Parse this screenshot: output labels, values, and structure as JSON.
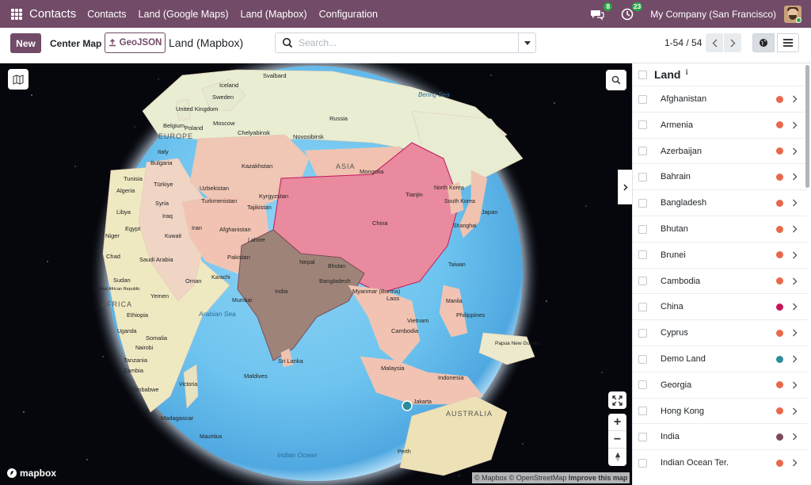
{
  "navbar": {
    "app_name": "Contacts",
    "menu": [
      "Contacts",
      "Land (Google Maps)",
      "Land (Mapbox)",
      "Configuration"
    ],
    "messages_count": "8",
    "activities_count": "23",
    "company": "My Company (San Francisco)"
  },
  "control": {
    "new_label": "New",
    "center_map_label": "Center Map",
    "geojson_label": "GeoJSON",
    "breadcrumb": "Land (Mapbox)",
    "search_placeholder": "Search...",
    "pager": "1-54 / 54"
  },
  "map": {
    "attribution_mapbox": "© Mapbox",
    "attribution_osm": "© OpenStreetMap",
    "attribution_improve": "Improve this map",
    "logo_text": "mapbox",
    "labels": [
      {
        "t": "Svalbard"
      },
      {
        "t": "Iceland"
      },
      {
        "t": "Sweden"
      },
      {
        "t": "Russia"
      },
      {
        "t": "United Kingdom"
      },
      {
        "t": "Moscow"
      },
      {
        "t": "Belgium"
      },
      {
        "t": "Poland"
      },
      {
        "t": "Chelyabinsk"
      },
      {
        "t": "Novosibirsk"
      },
      {
        "t": "EUROPE"
      },
      {
        "t": "Italy"
      },
      {
        "t": "Bulgaria"
      },
      {
        "t": "Kazakhstan"
      },
      {
        "t": "Mongolia"
      },
      {
        "t": "ASIA"
      },
      {
        "t": "Tunisia"
      },
      {
        "t": "Türkiye"
      },
      {
        "t": "Uzbekistan"
      },
      {
        "t": "Algeria"
      },
      {
        "t": "Syria"
      },
      {
        "t": "Kyrgyzstan"
      },
      {
        "t": "Turkmenistan"
      },
      {
        "t": "Tajikistan"
      },
      {
        "t": "North Korea"
      },
      {
        "t": "Tianjin"
      },
      {
        "t": "Libya"
      },
      {
        "t": "Iraq"
      },
      {
        "t": "South Korea"
      },
      {
        "t": "Japan"
      },
      {
        "t": "Afghanistan"
      },
      {
        "t": "China"
      },
      {
        "t": "Niger"
      },
      {
        "t": "Egypt"
      },
      {
        "t": "Kuwait"
      },
      {
        "t": "Iran"
      },
      {
        "t": "Lahore"
      },
      {
        "t": "Shanghai"
      },
      {
        "t": "Chad"
      },
      {
        "t": "Saudi Arabia"
      },
      {
        "t": "Pakistan"
      },
      {
        "t": "Nepal"
      },
      {
        "t": "Bhutan"
      },
      {
        "t": "Taiwan"
      },
      {
        "t": "Sudan"
      },
      {
        "t": "Oman"
      },
      {
        "t": "Karachi"
      },
      {
        "t": "Bangladesh"
      },
      {
        "t": "Central African Republic"
      },
      {
        "t": "AFRICA"
      },
      {
        "t": "Yemen"
      },
      {
        "t": "India"
      },
      {
        "t": "Myanmar (Burma)"
      },
      {
        "t": "Laos"
      },
      {
        "t": "Manila"
      },
      {
        "t": "Mumbai"
      },
      {
        "t": "Ethiopia"
      },
      {
        "t": "Arabian Sea"
      },
      {
        "t": "Philippines"
      },
      {
        "t": "Vietnam"
      },
      {
        "t": "Uganda"
      },
      {
        "t": "Somalia"
      },
      {
        "t": "Cambodia"
      },
      {
        "t": "Nairobi"
      },
      {
        "t": "Papua New Guinea"
      },
      {
        "t": "Tanzania"
      },
      {
        "t": "Sri Lanka"
      },
      {
        "t": "Zambia"
      },
      {
        "t": "Maldives"
      },
      {
        "t": "Malaysia"
      },
      {
        "t": "Indonesia"
      },
      {
        "t": "Zimbabwe"
      },
      {
        "t": "Victoria"
      },
      {
        "t": "Bering Sea"
      },
      {
        "t": "Madagascar"
      },
      {
        "t": "Jakarta"
      },
      {
        "t": "AUSTRALIA"
      },
      {
        "t": "Mauritius"
      },
      {
        "t": "Indian Ocean"
      },
      {
        "t": "Perth"
      }
    ]
  },
  "panel": {
    "title": "Land",
    "rows": [
      {
        "label": "Afghanistan",
        "color": "#e8684a"
      },
      {
        "label": "Armenia",
        "color": "#e8684a"
      },
      {
        "label": "Azerbaijan",
        "color": "#e8684a"
      },
      {
        "label": "Bahrain",
        "color": "#e8684a"
      },
      {
        "label": "Bangladesh",
        "color": "#e8684a"
      },
      {
        "label": "Bhutan",
        "color": "#e8684a"
      },
      {
        "label": "Brunei",
        "color": "#e8684a"
      },
      {
        "label": "Cambodia",
        "color": "#e8684a"
      },
      {
        "label": "China",
        "color": "#c2185b"
      },
      {
        "label": "Cyprus",
        "color": "#e8684a"
      },
      {
        "label": "Demo Land",
        "color": "#2a8c9c"
      },
      {
        "label": "Georgia",
        "color": "#e8684a"
      },
      {
        "label": "Hong Kong",
        "color": "#e8684a"
      },
      {
        "label": "India",
        "color": "#7b4a58"
      },
      {
        "label": "Indian Ocean Ter.",
        "color": "#e8684a"
      }
    ]
  }
}
